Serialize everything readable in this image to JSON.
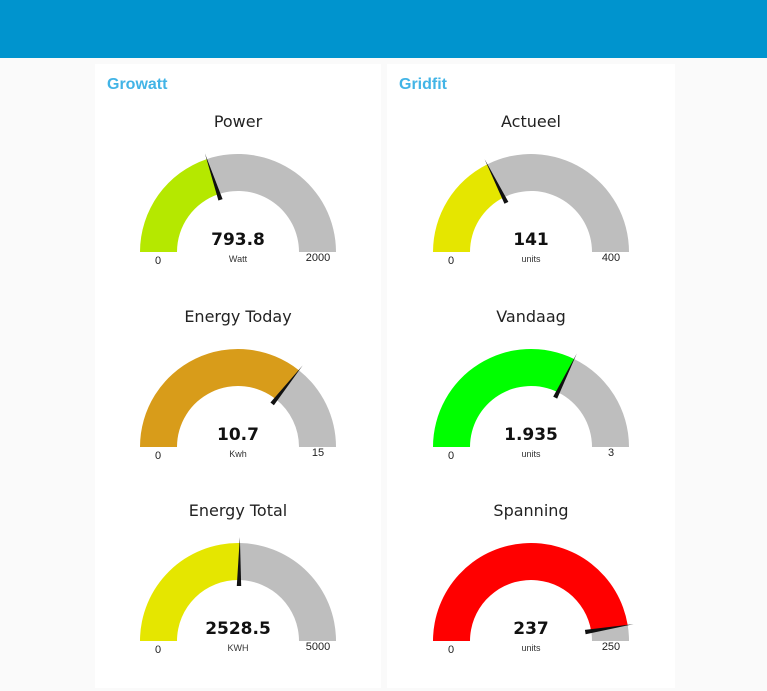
{
  "header": {
    "background": "#0094ce"
  },
  "groups": [
    {
      "title": "Growatt",
      "gauges": [
        {
          "label": "Power",
          "value": 793.8,
          "display": "793.8",
          "unit": "Watt",
          "min": 0,
          "max": 2000,
          "min_label": "0",
          "max_label": "2000",
          "color": "#b5e800"
        },
        {
          "label": "Energy Today",
          "value": 10.7,
          "display": "10.7",
          "unit": "Kwh",
          "min": 0,
          "max": 15,
          "min_label": "0",
          "max_label": "15",
          "color": "#d89c1a"
        },
        {
          "label": "Energy Total",
          "value": 2528.5,
          "display": "2528.5",
          "unit": "KWH",
          "min": 0,
          "max": 5000,
          "min_label": "0",
          "max_label": "5000",
          "color": "#e5e600"
        }
      ]
    },
    {
      "title": "Gridfit",
      "gauges": [
        {
          "label": "Actueel",
          "value": 141,
          "display": "141",
          "unit": "units",
          "min": 0,
          "max": 400,
          "min_label": "0",
          "max_label": "400",
          "color": "#e5e600"
        },
        {
          "label": "Vandaag",
          "value": 1.935,
          "display": "1.935",
          "unit": "units",
          "min": 0,
          "max": 3,
          "min_label": "0",
          "max_label": "3",
          "color": "#00ff00"
        },
        {
          "label": "Spanning",
          "value": 237,
          "display": "237",
          "unit": "units",
          "min": 0,
          "max": 250,
          "min_label": "0",
          "max_label": "250",
          "color": "#ff0000"
        }
      ]
    }
  ],
  "gauge_track_color": "#bebebe",
  "needle_color": "#111111"
}
